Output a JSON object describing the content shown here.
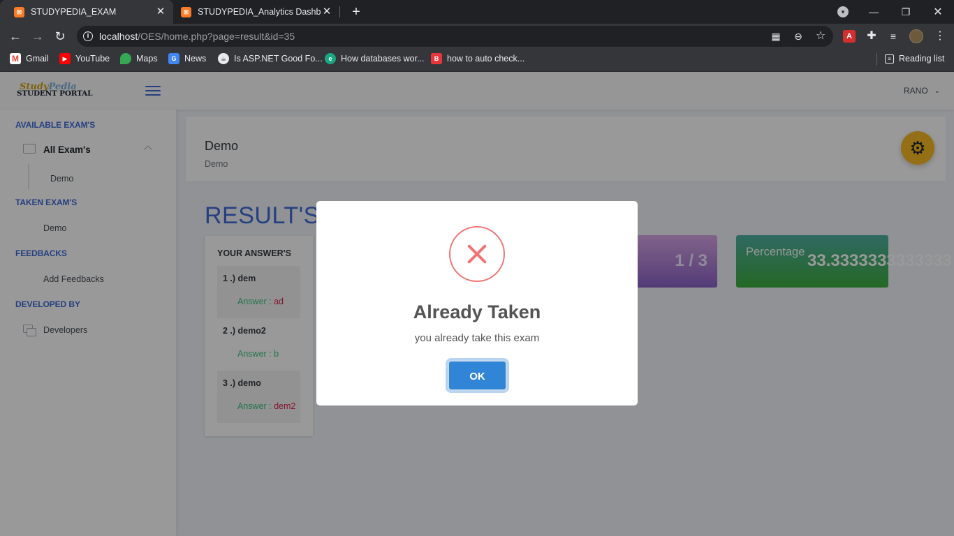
{
  "browser": {
    "tabs": [
      {
        "title": "STUDYPEDIA_EXAM",
        "active": true
      },
      {
        "title": "STUDYPEDIA_Analytics Dashboar",
        "active": false
      }
    ],
    "url_host": "localhost",
    "url_path": "/OES/home.php?page=result&id=35",
    "bookmarks": [
      "Gmail",
      "YouTube",
      "Maps",
      "News",
      "Is ASP.NET Good Fo...",
      "How databases wor...",
      "how to auto check..."
    ],
    "reading_list": "Reading list"
  },
  "app": {
    "logo_line1": "Study",
    "logo_line1b": "Pedia",
    "logo_line2": "STUDENT PORTAL",
    "user_name": "RANO"
  },
  "sidebar": {
    "available_heading": "AVAILABLE EXAM'S",
    "all_exams": "All Exam's",
    "available_exam": "Demo",
    "taken_heading": "TAKEN EXAM'S",
    "taken_exam": "Demo",
    "feedbacks_heading": "FEEDBACKS",
    "add_feedbacks": "Add Feedbacks",
    "developed_heading": "DEVELOPED BY",
    "developers": "Developers"
  },
  "header": {
    "title": "Demo",
    "subtitle": "Demo"
  },
  "results": {
    "heading": "RESULT'S",
    "answers_heading": "YOUR ANSWER'S",
    "answer_prefix": "Answer : ",
    "answers": [
      {
        "question": "1 .) dem",
        "answer": "ad",
        "correct": false
      },
      {
        "question": "2 .) demo2",
        "answer": "b",
        "correct": true
      },
      {
        "question": "3 .) demo",
        "answer": "dem2",
        "correct": false
      }
    ],
    "score": "1 / 3",
    "percentage_label": "Percentage",
    "percentage_value": "33.3333333333333"
  },
  "modal": {
    "title": "Already Taken",
    "text": "you already take this exam",
    "ok_label": "OK"
  },
  "colors": {
    "accent": "#3f6ad8",
    "modal_error": "#f27474",
    "ok_button": "#3085d6",
    "gear_button": "#f7b924"
  }
}
